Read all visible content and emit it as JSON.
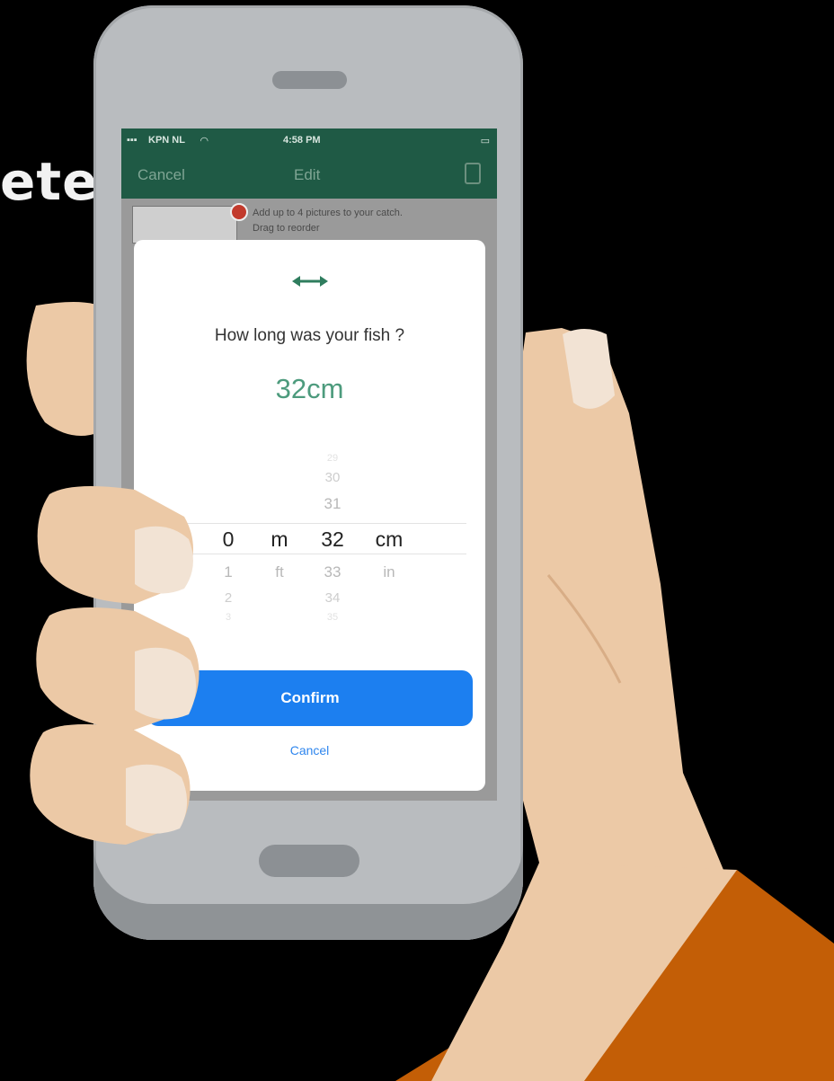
{
  "background": {
    "partial_word": "ete"
  },
  "status_bar": {
    "carrier": "KPN NL",
    "time": "4:58 PM"
  },
  "nav_bar": {
    "cancel_label": "Cancel",
    "title": "Edit",
    "delete_icon": "trash-icon"
  },
  "app_behind": {
    "hint_line1": "Add up to 4 pictures to your catch.",
    "hint_line2": "Drag to reorder"
  },
  "modal": {
    "icon": "horizontal-arrow-icon",
    "question": "How long was your fish ?",
    "value_display": "32cm",
    "picker": {
      "whole_column": {
        "above": [],
        "selected": "0",
        "below": [
          "1",
          "2",
          "3"
        ]
      },
      "whole_unit_column": {
        "above": [],
        "selected": "m",
        "below": [
          "ft"
        ]
      },
      "fraction_column": {
        "above": [
          "29",
          "30",
          "31"
        ],
        "selected": "32",
        "below": [
          "33",
          "34",
          "35"
        ]
      },
      "fraction_unit_column": {
        "above": [],
        "selected": "cm",
        "below": [
          "in"
        ]
      }
    },
    "confirm_label": "Confirm",
    "cancel_label": "Cancel"
  },
  "colors": {
    "accent_green": "#1f5a45",
    "value_green": "#4d9b7d",
    "confirm_blue": "#1c7ff0",
    "shirt_orange": "#c35e06",
    "skin": "#ecc9a6"
  }
}
